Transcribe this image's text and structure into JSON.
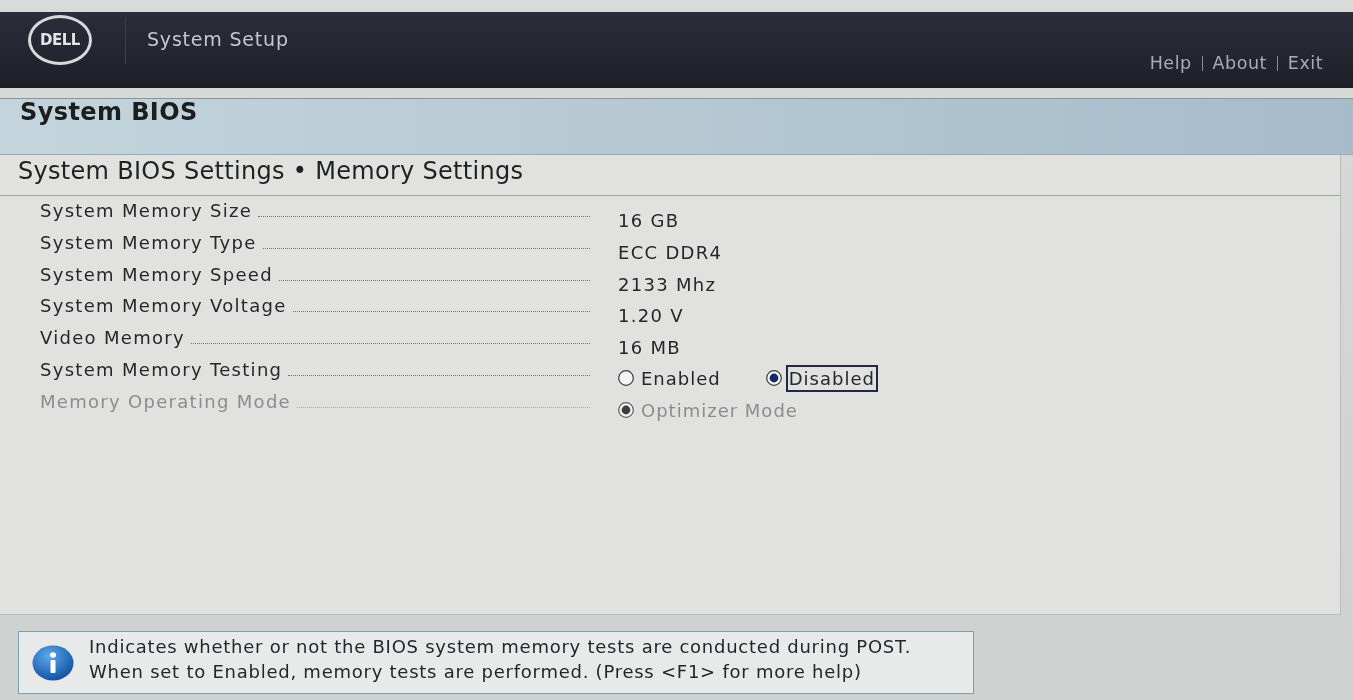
{
  "header": {
    "logo_text": "DELL",
    "title": "System Setup",
    "links": [
      "Help",
      "About",
      "Exit"
    ]
  },
  "page_title": "System BIOS",
  "section_title": "System BIOS Settings • Memory Settings",
  "settings": [
    {
      "label": "System Memory Size",
      "kind": "value",
      "disabled": false,
      "value": "16 GB"
    },
    {
      "label": "System Memory Type",
      "kind": "value",
      "disabled": false,
      "value": "ECC DDR4"
    },
    {
      "label": "System Memory Speed",
      "kind": "value",
      "disabled": false,
      "value": "2133 Mhz"
    },
    {
      "label": "System Memory Voltage",
      "kind": "value",
      "disabled": false,
      "value": "1.20 V"
    },
    {
      "label": "Video Memory",
      "kind": "value",
      "disabled": false,
      "value": "16 MB"
    },
    {
      "label": "System Memory Testing",
      "kind": "radio",
      "disabled": false,
      "options": [
        {
          "label": "Enabled",
          "selected": false,
          "focused": false
        },
        {
          "label": "Disabled",
          "selected": true,
          "focused": true
        }
      ]
    },
    {
      "label": "Memory Operating Mode",
      "kind": "radio",
      "disabled": true,
      "options": [
        {
          "label": "Optimizer Mode",
          "selected": true,
          "focused": false
        }
      ]
    }
  ],
  "help": {
    "lines": [
      "Indicates whether or not the BIOS system memory tests are conducted during POST.",
      "When set to Enabled, memory tests are performed. (Press <F1> for more help)"
    ]
  }
}
